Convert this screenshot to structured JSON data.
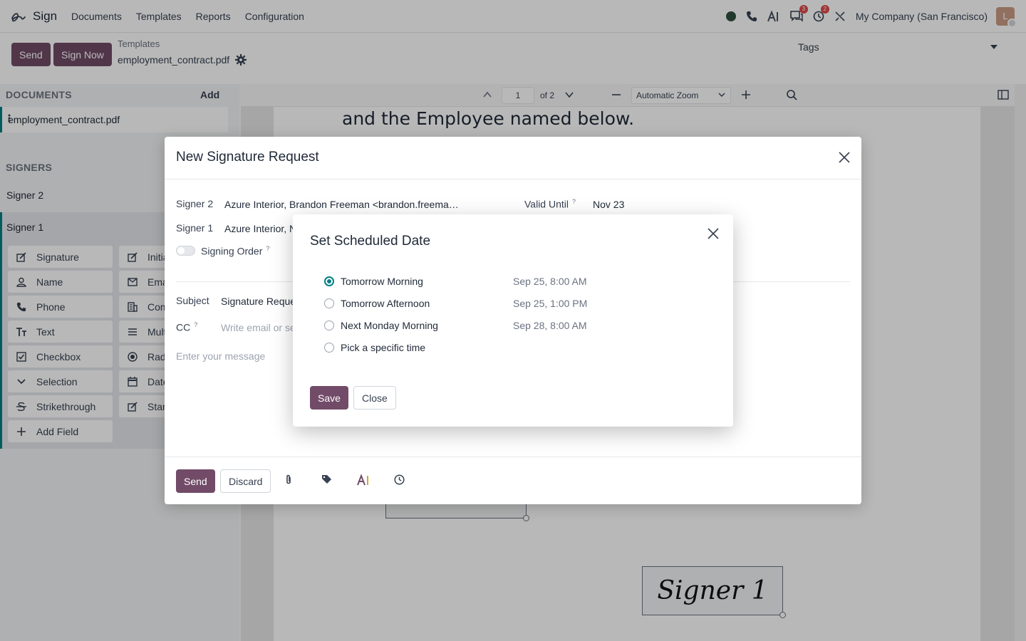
{
  "nav": {
    "app_name": "Sign",
    "menu": [
      "Documents",
      "Templates",
      "Reports",
      "Configuration"
    ],
    "messages_count": "3",
    "activities_count": "2",
    "company": "My Company (San Francisco)",
    "avatar_initial": "L"
  },
  "control": {
    "send_label": "Send",
    "sign_now_label": "Sign Now",
    "breadcrumb": "Templates",
    "current_file": "employment_contract.pdf",
    "tags_label": "Tags"
  },
  "sidebar": {
    "documents_heading": "DOCUMENTS",
    "add_label": "Add",
    "document_name": "employment_contract.pdf",
    "signers_heading": "SIGNERS",
    "signer_2": "Signer 2",
    "signer_1": "Signer 1",
    "fields_left": [
      "Signature",
      "Name",
      "Phone",
      "Text",
      "Checkbox",
      "Selection",
      "Strikethrough",
      "Add Field"
    ],
    "fields_right": [
      "Initia",
      "Ema",
      "Com",
      "Multi",
      "Radi",
      "Date",
      "Stan"
    ]
  },
  "viewer": {
    "page_number": "1",
    "page_total": "of 2",
    "zoom": "Automatic Zoom",
    "page_text": "and the Employee named below.",
    "signature_text": "Signer 1"
  },
  "request_dialog": {
    "title": "New Signature Request",
    "signer2_label": "Signer 2",
    "signer2_value": "Azure Interior, Brandon Freeman <brandon.freema…",
    "signer1_label": "Signer 1",
    "signer1_value": "Azure Interior, N",
    "valid_until_label": "Valid Until",
    "valid_until_value": "Nov 23",
    "signing_order_label": "Signing Order",
    "help_mark": "?",
    "subject_label": "Subject",
    "subject_value": "Signature Reque",
    "cc_label": "CC",
    "cc_placeholder": "Write email or se",
    "message_placeholder": "Enter your message",
    "send_label": "Send",
    "discard_label": "Discard"
  },
  "schedule_dialog": {
    "title": "Set Scheduled Date",
    "options": [
      {
        "label": "Tomorrow Morning",
        "time": "Sep 25, 8:00 AM",
        "selected": true
      },
      {
        "label": "Tomorrow Afternoon",
        "time": "Sep 25, 1:00 PM",
        "selected": false
      },
      {
        "label": "Next Monday Morning",
        "time": "Sep 28, 8:00 AM",
        "selected": false
      },
      {
        "label": "Pick a specific time",
        "time": "",
        "selected": false
      }
    ],
    "save_label": "Save",
    "close_label": "Close"
  },
  "colors": {
    "primary": "#714b67",
    "accent": "#017e84",
    "badge": "#e0494a"
  }
}
